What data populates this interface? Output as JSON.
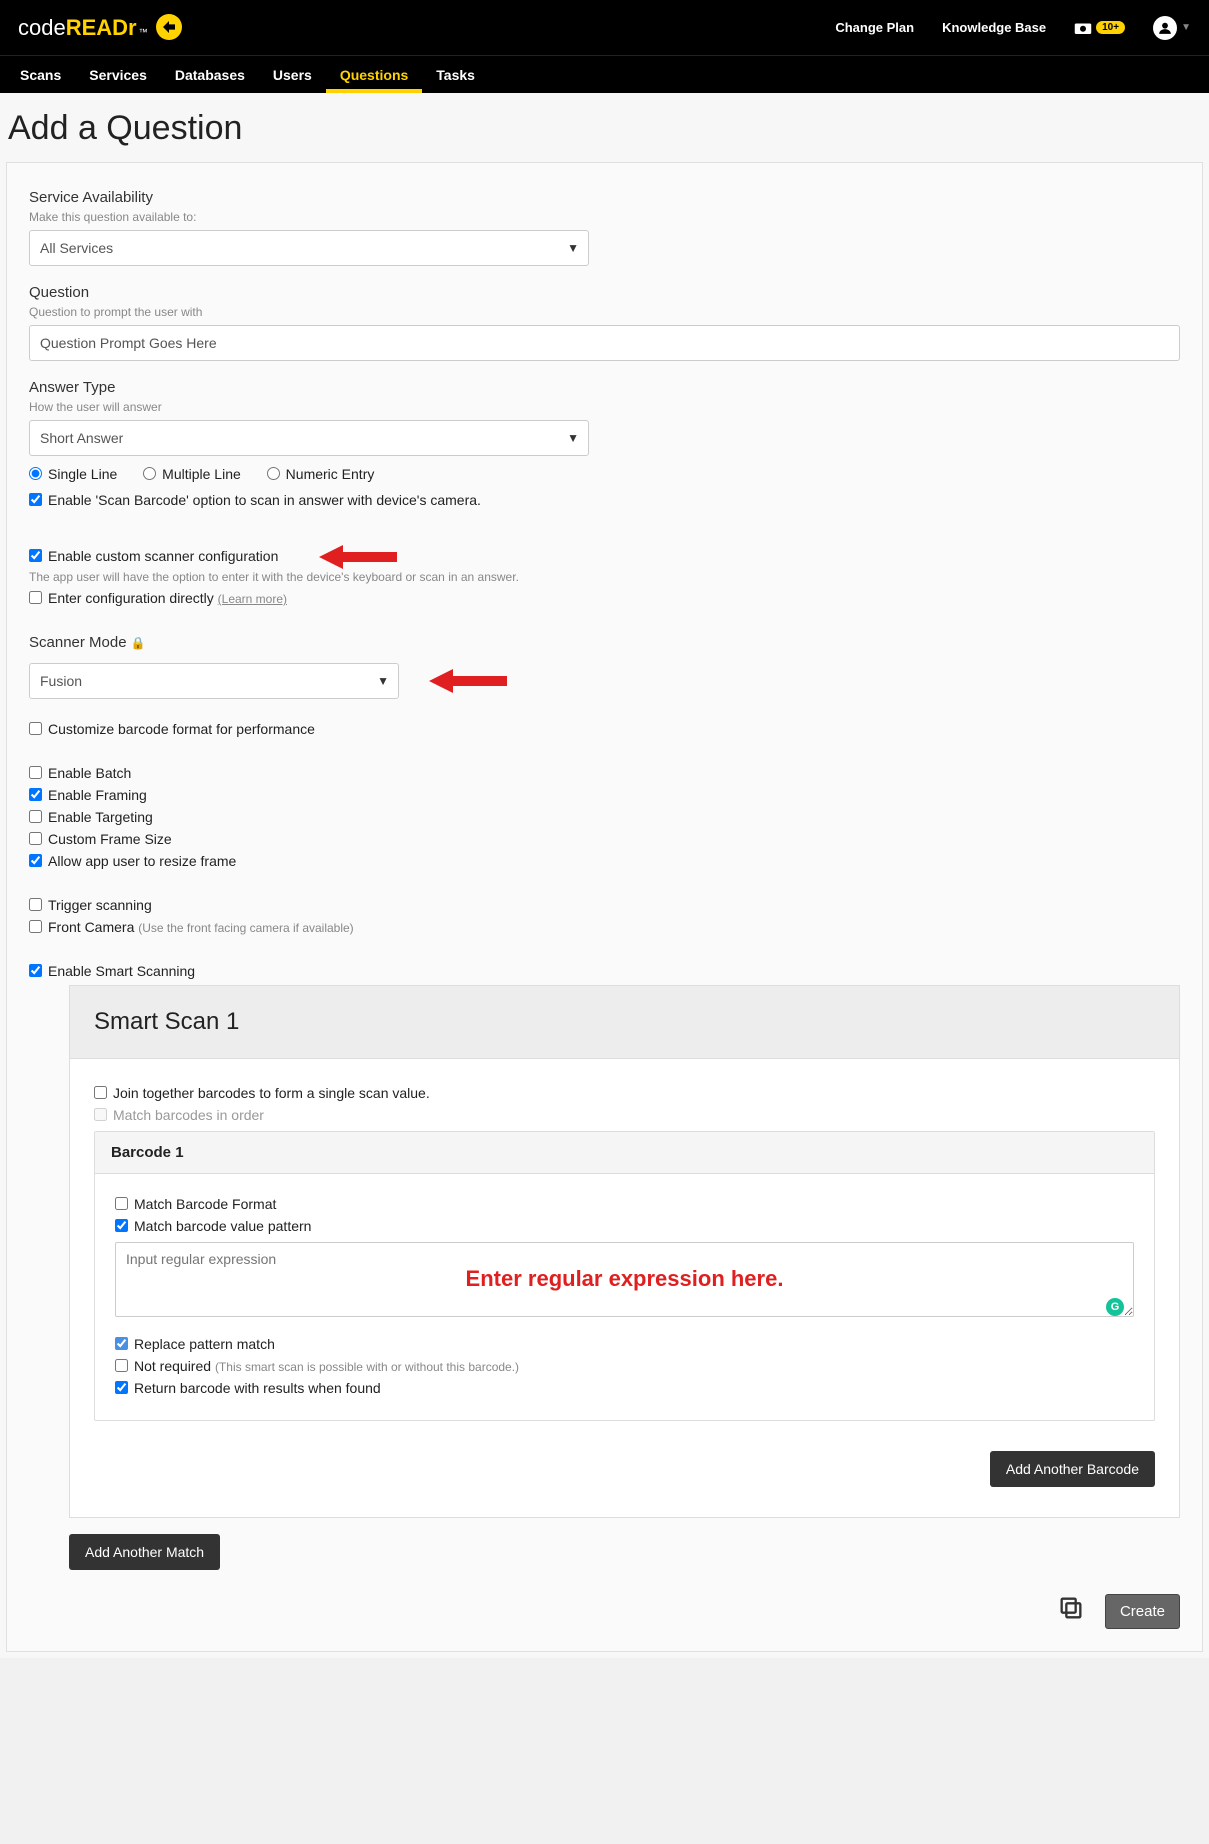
{
  "header": {
    "logo_code": "code",
    "logo_readr": "READr",
    "logo_tm": "™",
    "change_plan": "Change Plan",
    "knowledge_base": "Knowledge Base",
    "notif_count": "10+",
    "nav": {
      "scans": "Scans",
      "services": "Services",
      "databases": "Databases",
      "users": "Users",
      "questions": "Questions",
      "tasks": "Tasks"
    }
  },
  "page_title": "Add a Question",
  "sections": {
    "availability": {
      "title": "Service Availability",
      "subtitle": "Make this question available to:",
      "value": "All Services"
    },
    "question": {
      "title": "Question",
      "subtitle": "Question to prompt the user with",
      "value": "Question Prompt Goes Here"
    },
    "answer_type": {
      "title": "Answer Type",
      "subtitle": "How the user will answer",
      "value": "Short Answer",
      "radio_single": "Single Line",
      "radio_multiple": "Multiple Line",
      "radio_numeric": "Numeric Entry"
    },
    "scan_barcode_label": "Enable 'Scan Barcode' option to scan in answer with device's camera.",
    "custom_scanner_label": "Enable custom scanner configuration",
    "custom_scanner_hint": "The app user will have the option to enter it with the device's keyboard or scan in an answer.",
    "enter_config_label": "Enter configuration directly",
    "learn_more": "(Learn more)",
    "scanner_mode": {
      "title": "Scanner Mode",
      "value": "Fusion"
    },
    "customize_format": "Customize barcode format for performance",
    "enable_batch": "Enable Batch",
    "enable_framing": "Enable Framing",
    "enable_targeting": "Enable Targeting",
    "custom_frame_size": "Custom Frame Size",
    "allow_resize": "Allow app user to resize frame",
    "trigger_scanning": "Trigger scanning",
    "front_camera": "Front Camera",
    "front_camera_hint": "(Use the front facing camera if available)",
    "enable_smart": "Enable Smart Scanning",
    "smart": {
      "title": "Smart Scan 1",
      "join_label": "Join together barcodes to form a single scan value.",
      "match_order_label": "Match barcodes in order",
      "barcode_title": "Barcode 1",
      "match_format": "Match Barcode Format",
      "match_pattern": "Match barcode value pattern",
      "regex_placeholder": "Input regular expression",
      "regex_annotation": "Enter regular expression here.",
      "replace_label": "Replace pattern match",
      "not_required": "Not required",
      "not_required_hint": "(This smart scan is possible with or without this barcode.)",
      "return_label": "Return barcode with results when found",
      "add_barcode_btn": "Add Another Barcode"
    },
    "add_match_btn": "Add Another Match",
    "create_btn": "Create"
  }
}
